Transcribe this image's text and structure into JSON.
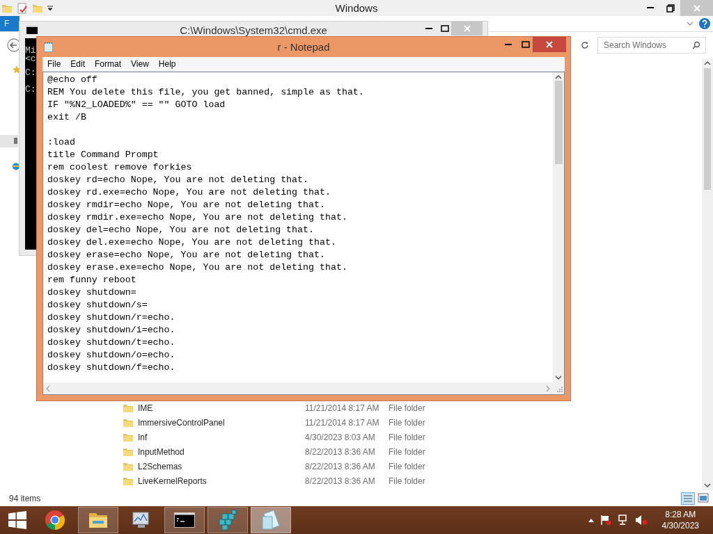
{
  "explorer": {
    "title": "Windows",
    "file_tab": "F",
    "search": {
      "placeholder": "Search Windows"
    },
    "files": [
      {
        "name": "IME",
        "date": "11/21/2014 8:17 AM",
        "type": "File folder"
      },
      {
        "name": "ImmersiveControlPanel",
        "date": "11/21/2014 8:17 AM",
        "type": "File folder"
      },
      {
        "name": "Inf",
        "date": "4/30/2023 8:03 AM",
        "type": "File folder"
      },
      {
        "name": "InputMethod",
        "date": "8/22/2013 8:36 AM",
        "type": "File folder"
      },
      {
        "name": "L2Schemas",
        "date": "8/22/2013 8:36 AM",
        "type": "File folder"
      },
      {
        "name": "LiveKernelReports",
        "date": "8/22/2013 8:36 AM",
        "type": "File folder"
      }
    ],
    "status": "94 items"
  },
  "cmd": {
    "title": "C:\\Windows\\System32\\cmd.exe",
    "lines": [
      "Mi",
      "<c",
      "C:",
      "C:"
    ]
  },
  "notepad": {
    "title": "r - Notepad",
    "menu": [
      "File",
      "Edit",
      "Format",
      "View",
      "Help"
    ],
    "paragraphs": [
      [
        "@echo off",
        "REM You delete this file, you get banned, simple as that.",
        "IF \"%N2_LOADED%\" == \"\" GOTO load",
        "exit /B"
      ],
      [
        ":load",
        "title Command Prompt",
        "rem coolest remove forkies",
        "doskey rd=echo Nope, You are not deleting that.",
        "doskey rd.exe=echo Nope, You are not deleting that.",
        "doskey rmdir=echo Nope, You are not deleting that.",
        "doskey rmdir.exe=echo Nope, You are not deleting that.",
        "doskey del=echo Nope, You are not deleting that.",
        "doskey del.exe=echo Nope, You are not deleting that.",
        "doskey erase=echo Nope, You are not deleting that.",
        "doskey erase.exe=echo Nope, You are not deleting that.",
        "rem funny reboot",
        "doskey shutdown=",
        "doskey shutdown/s=",
        "doskey shutdown/r=echo.",
        "doskey shutdown/i=echo.",
        "doskey shutdown/t=echo.",
        "doskey shutdown/o=echo.",
        "doskey shutdown/f=echo."
      ]
    ]
  },
  "taskbar": {
    "apps": [
      {
        "kind": "chrome",
        "running": false,
        "selected": false
      },
      {
        "kind": "explorer",
        "running": true,
        "selected": false
      },
      {
        "kind": "monitor",
        "running": false,
        "selected": false
      },
      {
        "kind": "cmd",
        "running": true,
        "selected": false
      },
      {
        "kind": "registry",
        "running": true,
        "selected": false
      },
      {
        "kind": "notepad",
        "running": true,
        "selected": true
      }
    ],
    "time": "8:28 AM",
    "date": "4/30/2023"
  }
}
